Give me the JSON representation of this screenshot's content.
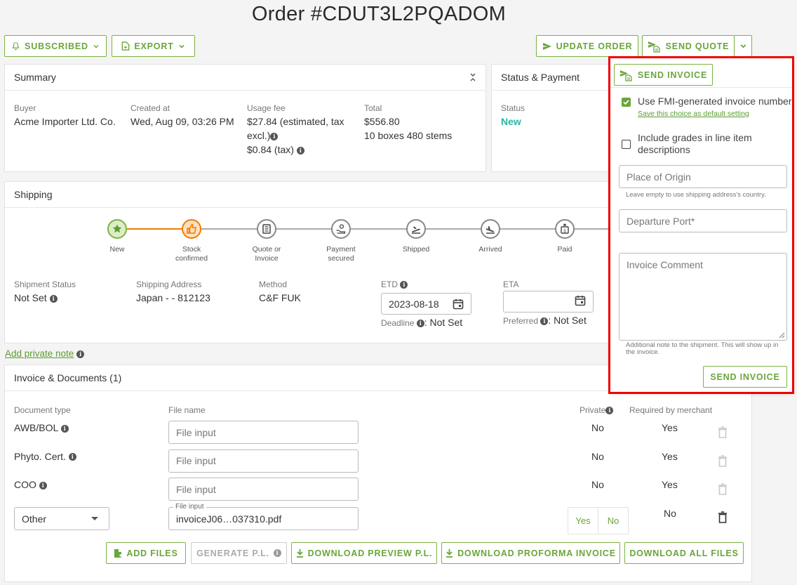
{
  "page": {
    "title": "Order #CDUT3L2PQADOM"
  },
  "toolbar": {
    "subscribed_label": "SUBSCRIBED",
    "export_label": "EXPORT",
    "update_order_label": "UPDATE ORDER",
    "send_quote_label": "SEND QUOTE"
  },
  "summary": {
    "header": "Summary",
    "buyer_label": "Buyer",
    "buyer_value": "Acme Importer Ltd. Co.",
    "created_label": "Created at",
    "created_value": "Wed, Aug 09, 03:26 PM",
    "usage_label": "Usage fee",
    "usage_line1": "$27.84 (estimated, tax",
    "usage_line2": "excl.)",
    "usage_line3": "$0.84 (tax)",
    "total_label": "Total",
    "total_value": "$556.80",
    "total_sub": "10 boxes 480 stems"
  },
  "status_payment": {
    "header": "Status & Payment",
    "status_label": "Status",
    "status_value": "New"
  },
  "shipping": {
    "header": "Shipping",
    "steps": [
      {
        "label": "New",
        "state": "done",
        "icon": "star-icon"
      },
      {
        "label": "Stock\nconfirmed",
        "state": "current",
        "icon": "thumbs-up-icon"
      },
      {
        "label": "Quote or\nInvoice",
        "state": "pending",
        "icon": "document-icon"
      },
      {
        "label": "Payment\nsecured",
        "state": "pending",
        "icon": "payment-icon"
      },
      {
        "label": "Shipped",
        "state": "pending",
        "icon": "plane-takeoff-icon"
      },
      {
        "label": "Arrived",
        "state": "pending",
        "icon": "plane-landing-icon"
      },
      {
        "label": "Paid",
        "state": "pending",
        "icon": "money-icon"
      }
    ],
    "shipment_status_label": "Shipment Status",
    "shipment_status_value": "Not Set",
    "address_label": "Shipping Address",
    "address_value": "Japan - - 812123",
    "method_label": "Method",
    "method_value": "C&F FUK",
    "etd_label": "ETD",
    "etd_value": "2023-08-18",
    "deadline_label": "Deadline",
    "deadline_value": ": Not Set",
    "eta_label": "ETA",
    "eta_value": "",
    "preferred_label": "Preferred",
    "preferred_value": ": Not Set"
  },
  "private_note": {
    "label": "Add private note"
  },
  "documents": {
    "header": "Invoice & Documents (1)",
    "col_type": "Document type",
    "col_file": "File name",
    "col_private": "Private",
    "col_required": "Required by merchant",
    "rows": [
      {
        "type": "AWB/BOL",
        "file_placeholder": "File input",
        "private": "No",
        "required": "Yes"
      },
      {
        "type": "Phyto. Cert.",
        "file_placeholder": "File input",
        "private": "No",
        "required": "Yes"
      },
      {
        "type": "COO",
        "file_placeholder": "File input",
        "private": "No",
        "required": "Yes"
      }
    ],
    "other_row": {
      "type_select": "Other",
      "file_label": "File input",
      "file_value": "invoiceJ06…037310.pdf",
      "private_yes": "Yes",
      "private_no": "No",
      "required": "No"
    },
    "buttons": {
      "add_files": "ADD FILES",
      "generate_pl": "GENERATE P.L.",
      "download_preview": "DOWNLOAD PREVIEW P.L.",
      "download_proforma": "DOWNLOAD PROFORMA INVOICE",
      "download_all": "DOWNLOAD ALL FILES"
    }
  },
  "invoice_popup": {
    "send_invoice_top": "SEND INVOICE",
    "use_fmi_label": "Use FMI-generated invoice number",
    "save_default_link": "Save this choice as default setting",
    "include_grades_label": "Include grades in line item descriptions",
    "place_of_origin_placeholder": "Place of Origin",
    "place_of_origin_hint": "Leave empty to use shipping address's country.",
    "departure_port_placeholder": "Departure Port*",
    "invoice_comment_placeholder": "Invoice Comment",
    "invoice_comment_hint": "Additional note to the shipment. This will show up in the invoice.",
    "send_invoice_button": "SEND INVOICE"
  },
  "colors": {
    "accent_green": "#6aa63a",
    "step_orange": "#ef7d00",
    "status_new": "#2bb5a3",
    "highlight_red": "#e00000"
  }
}
